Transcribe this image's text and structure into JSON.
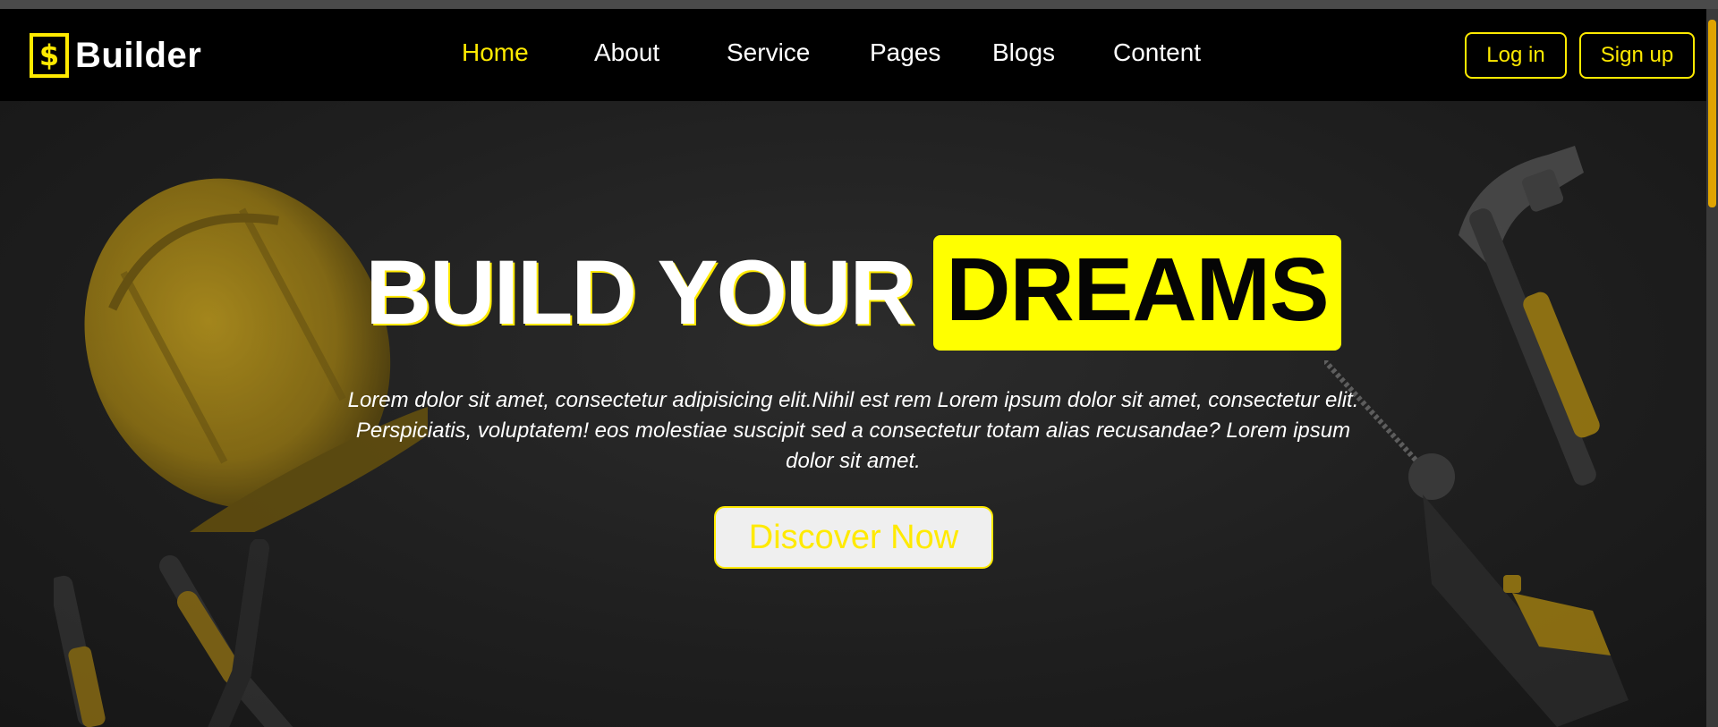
{
  "brand": {
    "mark": "$",
    "name": "Builder",
    "icon": "dollar-badge-icon"
  },
  "nav": {
    "items": [
      {
        "label": "Home",
        "active": true
      },
      {
        "label": "About"
      },
      {
        "label": "Service"
      },
      {
        "label": "Pages"
      },
      {
        "label": "Blogs"
      },
      {
        "label": "Content"
      }
    ],
    "login_label": "Log in",
    "signup_label": "Sign up"
  },
  "hero": {
    "headline_plain": "BUILD YOUR",
    "headline_highlight": "DREAMS",
    "description": "Lorem dolor sit amet, consectetur adipisicing elit.Nihil est rem Lorem ipsum dolor sit amet, consectetur elit. Perspiciatis, voluptatem! eos molestiae suscipit sed a consectetur totam alias recusandae? Lorem ipsum dolor sit amet.",
    "cta_label": "Discover Now",
    "background_icons": [
      "hard-hat-icon",
      "pliers-icon",
      "hammer-icon",
      "drill-icon"
    ]
  },
  "colors": {
    "accent": "#ffea00",
    "highlight": "#ffff00",
    "navbar_bg": "#000000",
    "hero_bg": "#1f1f1f",
    "text": "#ffffff"
  }
}
